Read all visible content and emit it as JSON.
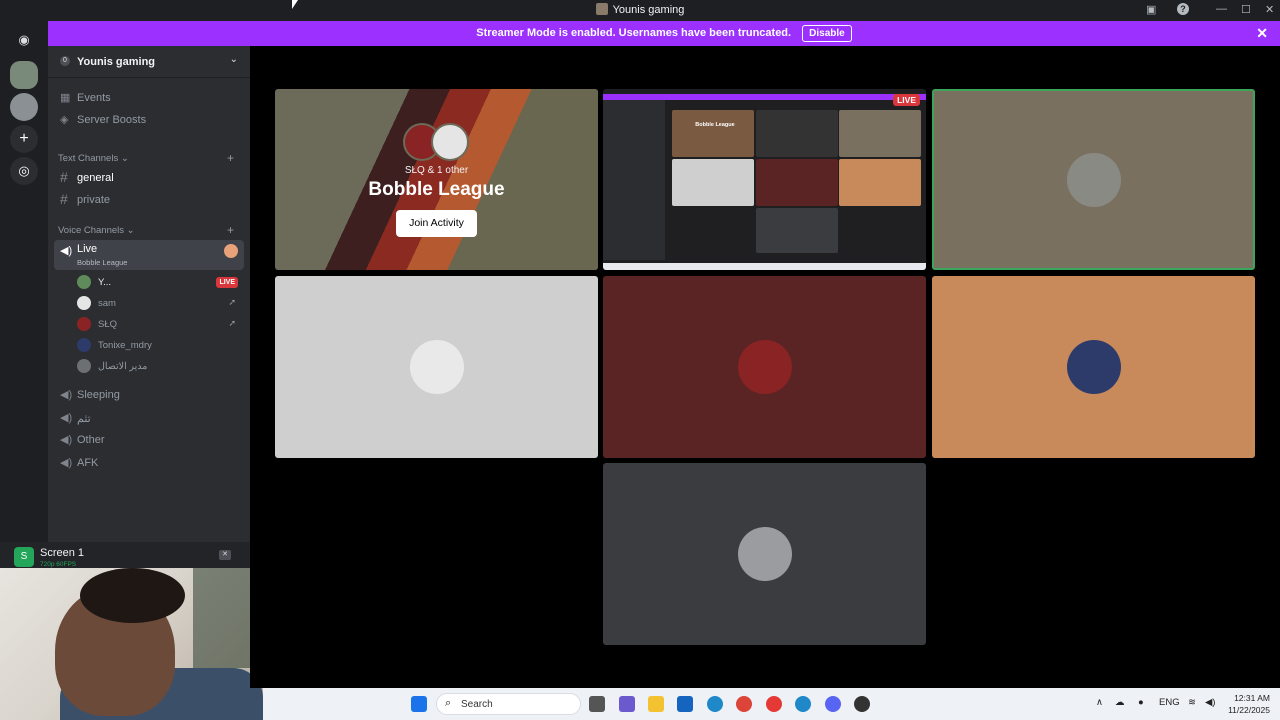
{
  "window": {
    "title": "Younis gaming",
    "help_icon": "?"
  },
  "banner": {
    "text": "Streamer Mode is enabled. Usernames have been truncated.",
    "button": "Disable",
    "close": "✕"
  },
  "server": {
    "name": "Younis gaming",
    "badge": "0",
    "chevron": "⌄"
  },
  "menu": {
    "events": "Events",
    "boosts": "Server Boosts"
  },
  "text_channels": {
    "header": "Text Channels ⌄",
    "items": [
      "general",
      "private"
    ]
  },
  "voice_channels": {
    "header": "Voice Channels ⌄",
    "live": {
      "name": "Live",
      "sub": "Bobble League"
    },
    "users": [
      {
        "name": "Y...",
        "badge": "LIVE"
      },
      {
        "name": "sam"
      },
      {
        "name": "SŁQ"
      },
      {
        "name": "Tonixe_mdry"
      },
      {
        "name": "مدير الاتصال"
      }
    ],
    "others": [
      "Sleeping",
      "تثم",
      "Other",
      "AFK"
    ]
  },
  "screen_panel": {
    "title": "Screen 1",
    "quality": "720p 60FPS"
  },
  "activity": {
    "sub": "SŁQ & 1 other",
    "title": "Bobble League",
    "button": "Join Activity"
  },
  "stream": {
    "live": "LIVE",
    "mini_title": "Bobble League"
  },
  "taskbar": {
    "search": "Search",
    "lang": "ENG",
    "time": "12:31 AM",
    "date": "11/22/2025"
  },
  "colors": {
    "banner": "#9b30ff",
    "live": "#da373c",
    "sidebar": "#2b2d31",
    "rail": "#1e1f22"
  }
}
